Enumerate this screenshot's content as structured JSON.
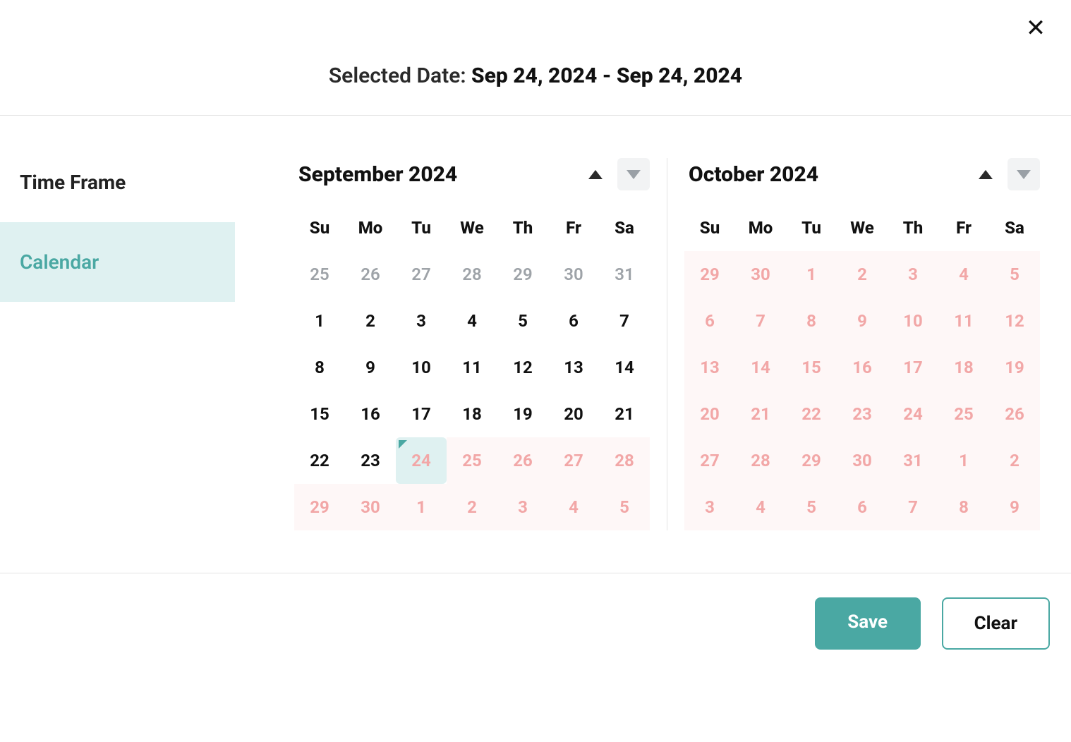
{
  "header": {
    "label": "Selected Date: ",
    "range": "Sep 24, 2024 - Sep 24, 2024"
  },
  "sidebar": {
    "title": "Time Frame",
    "items": [
      {
        "label": "Calendar",
        "active": true
      }
    ]
  },
  "dow": [
    "Su",
    "Mo",
    "Tu",
    "We",
    "Th",
    "Fr",
    "Sa"
  ],
  "months": [
    {
      "title": "September 2024",
      "prev_enabled": true,
      "next_enabled": false,
      "weeks": [
        [
          {
            "n": 25,
            "t": "out"
          },
          {
            "n": 26,
            "t": "out"
          },
          {
            "n": 27,
            "t": "out"
          },
          {
            "n": 28,
            "t": "out"
          },
          {
            "n": 29,
            "t": "out"
          },
          {
            "n": 30,
            "t": "out"
          },
          {
            "n": 31,
            "t": "out"
          }
        ],
        [
          {
            "n": 1,
            "t": "normal"
          },
          {
            "n": 2,
            "t": "normal"
          },
          {
            "n": 3,
            "t": "normal"
          },
          {
            "n": 4,
            "t": "normal"
          },
          {
            "n": 5,
            "t": "normal"
          },
          {
            "n": 6,
            "t": "normal"
          },
          {
            "n": 7,
            "t": "normal"
          }
        ],
        [
          {
            "n": 8,
            "t": "normal"
          },
          {
            "n": 9,
            "t": "normal"
          },
          {
            "n": 10,
            "t": "normal"
          },
          {
            "n": 11,
            "t": "normal"
          },
          {
            "n": 12,
            "t": "normal"
          },
          {
            "n": 13,
            "t": "normal"
          },
          {
            "n": 14,
            "t": "normal"
          }
        ],
        [
          {
            "n": 15,
            "t": "normal"
          },
          {
            "n": 16,
            "t": "normal"
          },
          {
            "n": 17,
            "t": "normal"
          },
          {
            "n": 18,
            "t": "normal"
          },
          {
            "n": 19,
            "t": "normal"
          },
          {
            "n": 20,
            "t": "normal"
          },
          {
            "n": 21,
            "t": "normal"
          }
        ],
        [
          {
            "n": 22,
            "t": "normal"
          },
          {
            "n": 23,
            "t": "normal"
          },
          {
            "n": 24,
            "t": "selected"
          },
          {
            "n": 25,
            "t": "future"
          },
          {
            "n": 26,
            "t": "future"
          },
          {
            "n": 27,
            "t": "future"
          },
          {
            "n": 28,
            "t": "future"
          }
        ],
        [
          {
            "n": 29,
            "t": "future"
          },
          {
            "n": 30,
            "t": "future"
          },
          {
            "n": 1,
            "t": "future"
          },
          {
            "n": 2,
            "t": "future"
          },
          {
            "n": 3,
            "t": "future"
          },
          {
            "n": 4,
            "t": "future"
          },
          {
            "n": 5,
            "t": "future"
          }
        ]
      ]
    },
    {
      "title": "October 2024",
      "prev_enabled": true,
      "next_enabled": false,
      "weeks": [
        [
          {
            "n": 29,
            "t": "future"
          },
          {
            "n": 30,
            "t": "future"
          },
          {
            "n": 1,
            "t": "future"
          },
          {
            "n": 2,
            "t": "future"
          },
          {
            "n": 3,
            "t": "future"
          },
          {
            "n": 4,
            "t": "future"
          },
          {
            "n": 5,
            "t": "future"
          }
        ],
        [
          {
            "n": 6,
            "t": "future"
          },
          {
            "n": 7,
            "t": "future"
          },
          {
            "n": 8,
            "t": "future"
          },
          {
            "n": 9,
            "t": "future"
          },
          {
            "n": 10,
            "t": "future"
          },
          {
            "n": 11,
            "t": "future"
          },
          {
            "n": 12,
            "t": "future"
          }
        ],
        [
          {
            "n": 13,
            "t": "future"
          },
          {
            "n": 14,
            "t": "future"
          },
          {
            "n": 15,
            "t": "future"
          },
          {
            "n": 16,
            "t": "future"
          },
          {
            "n": 17,
            "t": "future"
          },
          {
            "n": 18,
            "t": "future"
          },
          {
            "n": 19,
            "t": "future"
          }
        ],
        [
          {
            "n": 20,
            "t": "future"
          },
          {
            "n": 21,
            "t": "future"
          },
          {
            "n": 22,
            "t": "future"
          },
          {
            "n": 23,
            "t": "future"
          },
          {
            "n": 24,
            "t": "future"
          },
          {
            "n": 25,
            "t": "future"
          },
          {
            "n": 26,
            "t": "future"
          }
        ],
        [
          {
            "n": 27,
            "t": "future"
          },
          {
            "n": 28,
            "t": "future"
          },
          {
            "n": 29,
            "t": "future"
          },
          {
            "n": 30,
            "t": "future"
          },
          {
            "n": 31,
            "t": "future"
          },
          {
            "n": 1,
            "t": "future"
          },
          {
            "n": 2,
            "t": "future"
          }
        ],
        [
          {
            "n": 3,
            "t": "future"
          },
          {
            "n": 4,
            "t": "future"
          },
          {
            "n": 5,
            "t": "future"
          },
          {
            "n": 6,
            "t": "future"
          },
          {
            "n": 7,
            "t": "future"
          },
          {
            "n": 8,
            "t": "future"
          },
          {
            "n": 9,
            "t": "future"
          }
        ]
      ]
    }
  ],
  "footer": {
    "save": "Save",
    "clear": "Clear"
  },
  "colors": {
    "accent": "#4aa8a3",
    "future_text": "#f2a7a7",
    "future_bg": "#fef7f7",
    "selected_bg": "#dff1f1"
  }
}
